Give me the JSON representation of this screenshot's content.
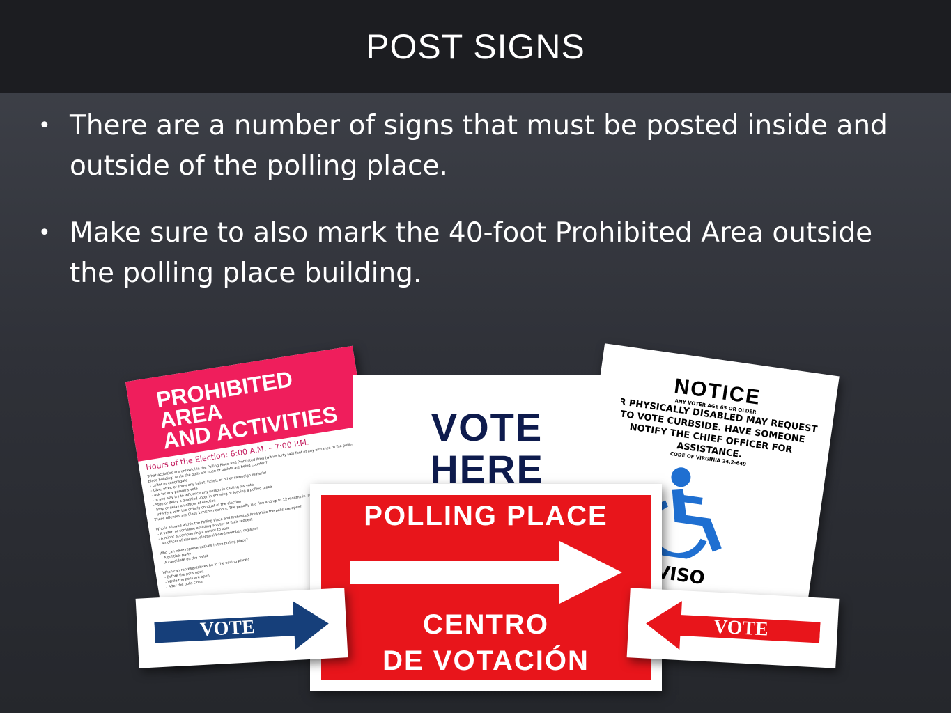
{
  "slide": {
    "title": "POST SIGNS",
    "bullets": [
      "There are a number of signs that must be posted inside and outside of the polling place.",
      "Make sure to also mark the 40-foot Prohibited Area outside the polling place building."
    ]
  },
  "signs": {
    "prohibited": {
      "title_line1": "PROHIBITED AREA",
      "title_line2": "AND ACTIVITIES",
      "hours": "Hours of the Election: 6:00 A.M. – 7:00 P.M.",
      "fine_print": "What activities are unlawful in the Polling Place and Prohibited Area (within forty (40) feet of any entrance to the polling place building) while the polls are open or ballots are being counted?\n - Loiter or congregate\n - Give, offer, or show any ballot, ticket, or other campaign material\n - Ask for any person's vote\n - In any way try to influence any person in casting his vote\n - Stop or delay a qualified voter in entering or leaving a polling place\n - Stop or delay an officer of election\n - Interfere with the orderly conduct of the election\nThese offenses are Class 1 misdemeanors. The penalty is a fine and up to 12 months in jail.\n\nWho is allowed within the Polling Place and Prohibited Area while the polls are open?\n - A voter, or someone assisting a voter at their request\n - A minor accompanying a parent to vote\n - An officer of election, electoral board member, registrar\n\nWho can have representatives in the polling place?\n - A political party\n - A candidate on the ballot\n\nWhen can representatives be in the polling place?\n - Before the polls open\n - While the polls are open\n - After the polls close"
    },
    "notice": {
      "title": "NOTICE",
      "subtitle": "ANY VOTER AGE 65 OR OLDER",
      "body": "OR PHYSICALLY DISABLED MAY REQUEST TO VOTE CURBSIDE. HAVE SOMEONE NOTIFY THE CHIEF OFFICER FOR ASSISTANCE.",
      "code": "CODE OF VIRGINIA 24.2-649",
      "aviso": "AVISO"
    },
    "vote_here": {
      "line1": "VOTE",
      "line2": "HERE"
    },
    "polling_place": {
      "line1": "POLLING PLACE",
      "line2": "CENTRO",
      "line3": "DE VOTACIÓN"
    },
    "vote_left": {
      "label": "VOTE",
      "color": "#163f7a"
    },
    "vote_right": {
      "label": "VOTE",
      "color": "#e8151b"
    }
  }
}
